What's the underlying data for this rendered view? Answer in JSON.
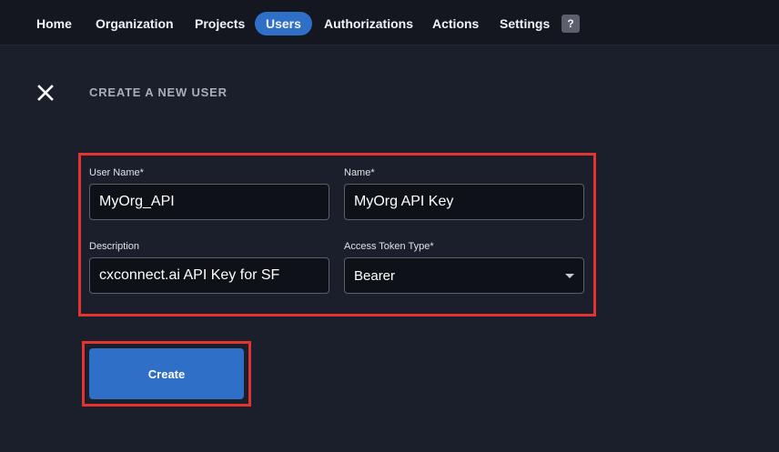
{
  "nav": {
    "items": [
      {
        "label": "Home",
        "active": false
      },
      {
        "label": "Organization",
        "active": false
      },
      {
        "label": "Projects",
        "active": false
      },
      {
        "label": "Users",
        "active": true
      },
      {
        "label": "Authorizations",
        "active": false
      },
      {
        "label": "Actions",
        "active": false
      },
      {
        "label": "Settings",
        "active": false
      }
    ],
    "help_label": "?"
  },
  "page": {
    "title": "CREATE A NEW USER",
    "close_icon": "close-icon"
  },
  "form": {
    "user_name": {
      "label": "User Name*",
      "value": "MyOrg_API"
    },
    "name": {
      "label": "Name*",
      "value": "MyOrg API Key"
    },
    "description": {
      "label": "Description",
      "value": "cxconnect.ai API Key for SF"
    },
    "access_token_type": {
      "label": "Access Token Type*",
      "value": "Bearer"
    }
  },
  "actions": {
    "create_label": "Create"
  },
  "colors": {
    "accent": "#2f6fc8",
    "background": "#1b1f2b",
    "highlight": "#e3342f"
  }
}
